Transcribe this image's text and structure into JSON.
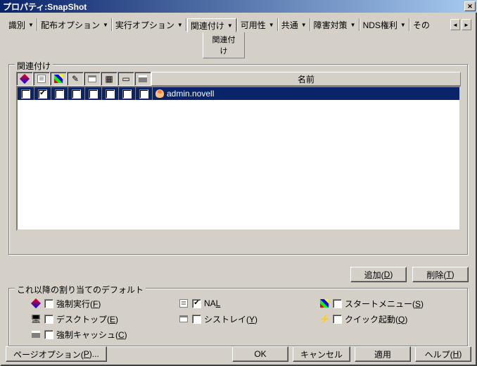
{
  "window": {
    "title": "プロパティ:SnapShot"
  },
  "tabs": {
    "items": [
      {
        "label": "識別",
        "dd": true
      },
      {
        "label": "配布オプション",
        "dd": true
      },
      {
        "label": "実行オプション",
        "dd": true
      },
      {
        "label": "関連付け",
        "dd": true,
        "active": true
      },
      {
        "label": "可用性",
        "dd": true
      },
      {
        "label": "共通",
        "dd": true
      },
      {
        "label": "障害対策",
        "dd": true
      },
      {
        "label": "NDS権利",
        "dd": true
      },
      {
        "label": "その",
        "dd": false
      }
    ],
    "subtab": "関連付け"
  },
  "assoc": {
    "legend": "関連付け",
    "name_header": "名前",
    "row_name": "admin.novell",
    "row_checks": [
      false,
      true,
      false,
      false,
      false,
      false,
      false,
      false
    ]
  },
  "buttons": {
    "add": "追加(D)",
    "remove": "削除(T)",
    "page_options": "ページオプション(P)...",
    "ok": "OK",
    "cancel": "キャンセル",
    "apply": "適用",
    "help": "ヘルプ(H)"
  },
  "defaults": {
    "legend": "これ以降の割り当てのデフォルト",
    "force_run": {
      "label": "強制実行(F)",
      "checked": false
    },
    "nal": {
      "label": "NAL",
      "checked": true
    },
    "start_menu": {
      "label": "スタートメニュー(S)",
      "checked": false
    },
    "desktop": {
      "label": "デスクトップ(E)",
      "checked": false
    },
    "systray": {
      "label": "シストレイ(Y)",
      "checked": false
    },
    "quick_launch": {
      "label": "クイック起動(Q)",
      "checked": false
    },
    "force_cache": {
      "label": "強制キャッシュ(C)",
      "checked": false
    }
  }
}
